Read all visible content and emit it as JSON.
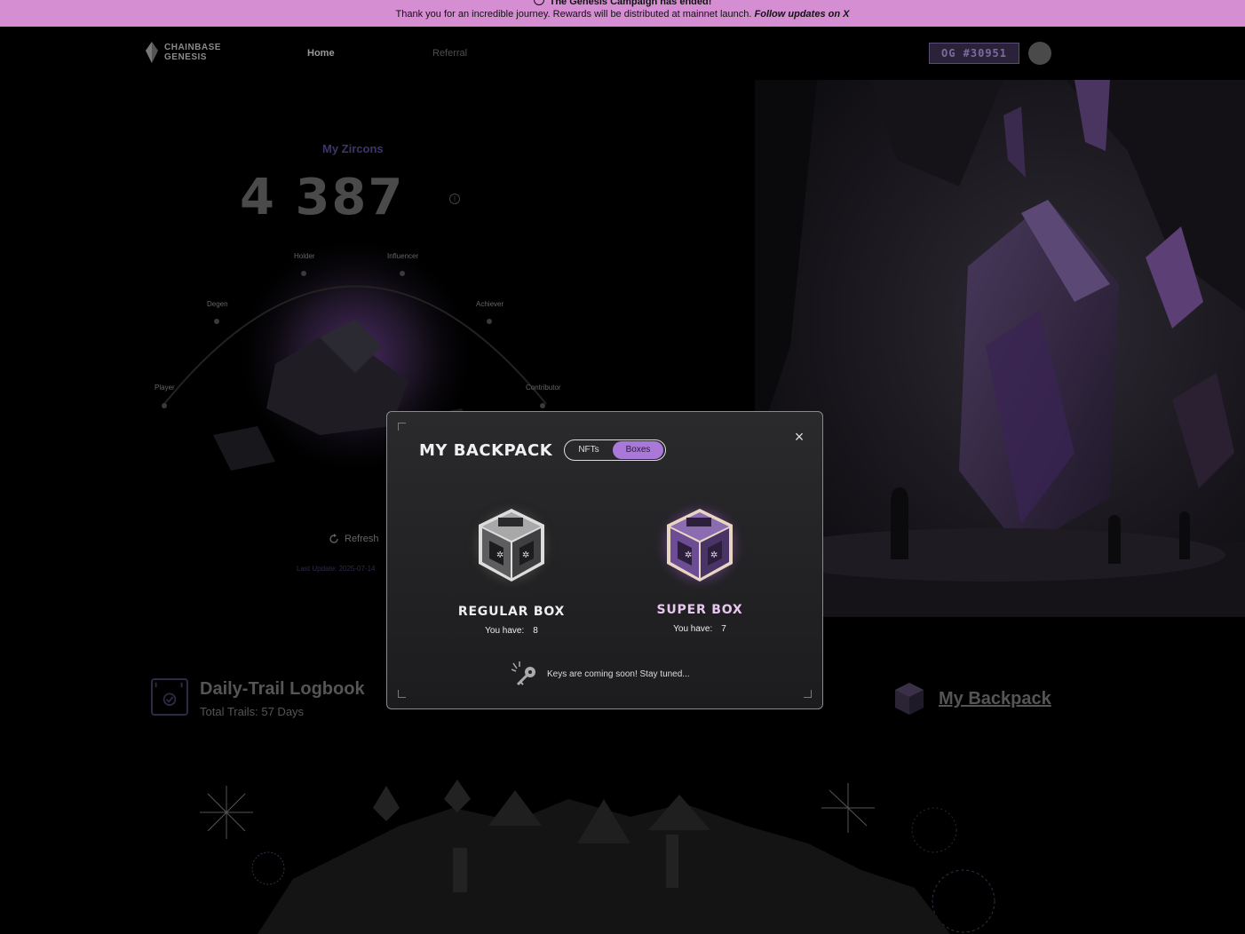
{
  "banner": {
    "line1": "The Genesis Campaign has ended!",
    "line2_text": "Thank you for an incredible journey. Rewards will be distributed at mainnet launch.",
    "line2_link": "Follow updates on X"
  },
  "nav": {
    "logo_line1": "CHAINBASE",
    "logo_line2": "GENESIS",
    "home": "Home",
    "referral": "Referral",
    "og_badge": "OG #30951"
  },
  "zircons": {
    "title": "My Zircons",
    "value": "4 387",
    "info": "i",
    "nodes": [
      "Player",
      "Degen",
      "Holder",
      "Influencer",
      "Achiever",
      "Contributor"
    ],
    "refresh": "Refresh",
    "last_update": "Last Update: 2025-07-14"
  },
  "logbook": {
    "title": "Daily-Trail Logbook",
    "subtitle": "Total Trails: 57 Days"
  },
  "backpack_link": "My Backpack",
  "modal": {
    "title": "MY BACKPACK",
    "tabs": [
      "NFTs",
      "Boxes"
    ],
    "active_tab": "Boxes",
    "close": "×",
    "boxes": [
      {
        "name": "REGULAR BOX",
        "have_label": "You have:",
        "count": "8"
      },
      {
        "name": "SUPER BOX",
        "have_label": "You have:",
        "count": "7"
      }
    ],
    "keys_note": "Keys are coming soon! Stay tuned..."
  },
  "colors": {
    "banner": "#d48ed1",
    "accent": "#a978d8",
    "background": "#000000"
  }
}
